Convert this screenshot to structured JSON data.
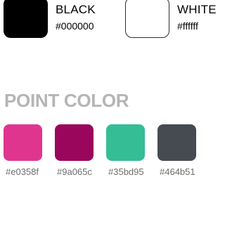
{
  "base_colors": [
    {
      "name": "BLACK",
      "hex": "#000000",
      "swatch_color": "#000000"
    },
    {
      "name": "WHITE",
      "hex": "#ffffff",
      "swatch_color": "#ffffff"
    }
  ],
  "point_section": {
    "title": "POINT COLOR",
    "colors": [
      {
        "hex": "#e0358f",
        "swatch_color": "#e0358f"
      },
      {
        "hex": "#9a065c",
        "swatch_color": "#9a065c"
      },
      {
        "hex": "#35bd95",
        "swatch_color": "#35bd95"
      },
      {
        "hex": "#464b51",
        "swatch_color": "#464b51"
      }
    ]
  }
}
